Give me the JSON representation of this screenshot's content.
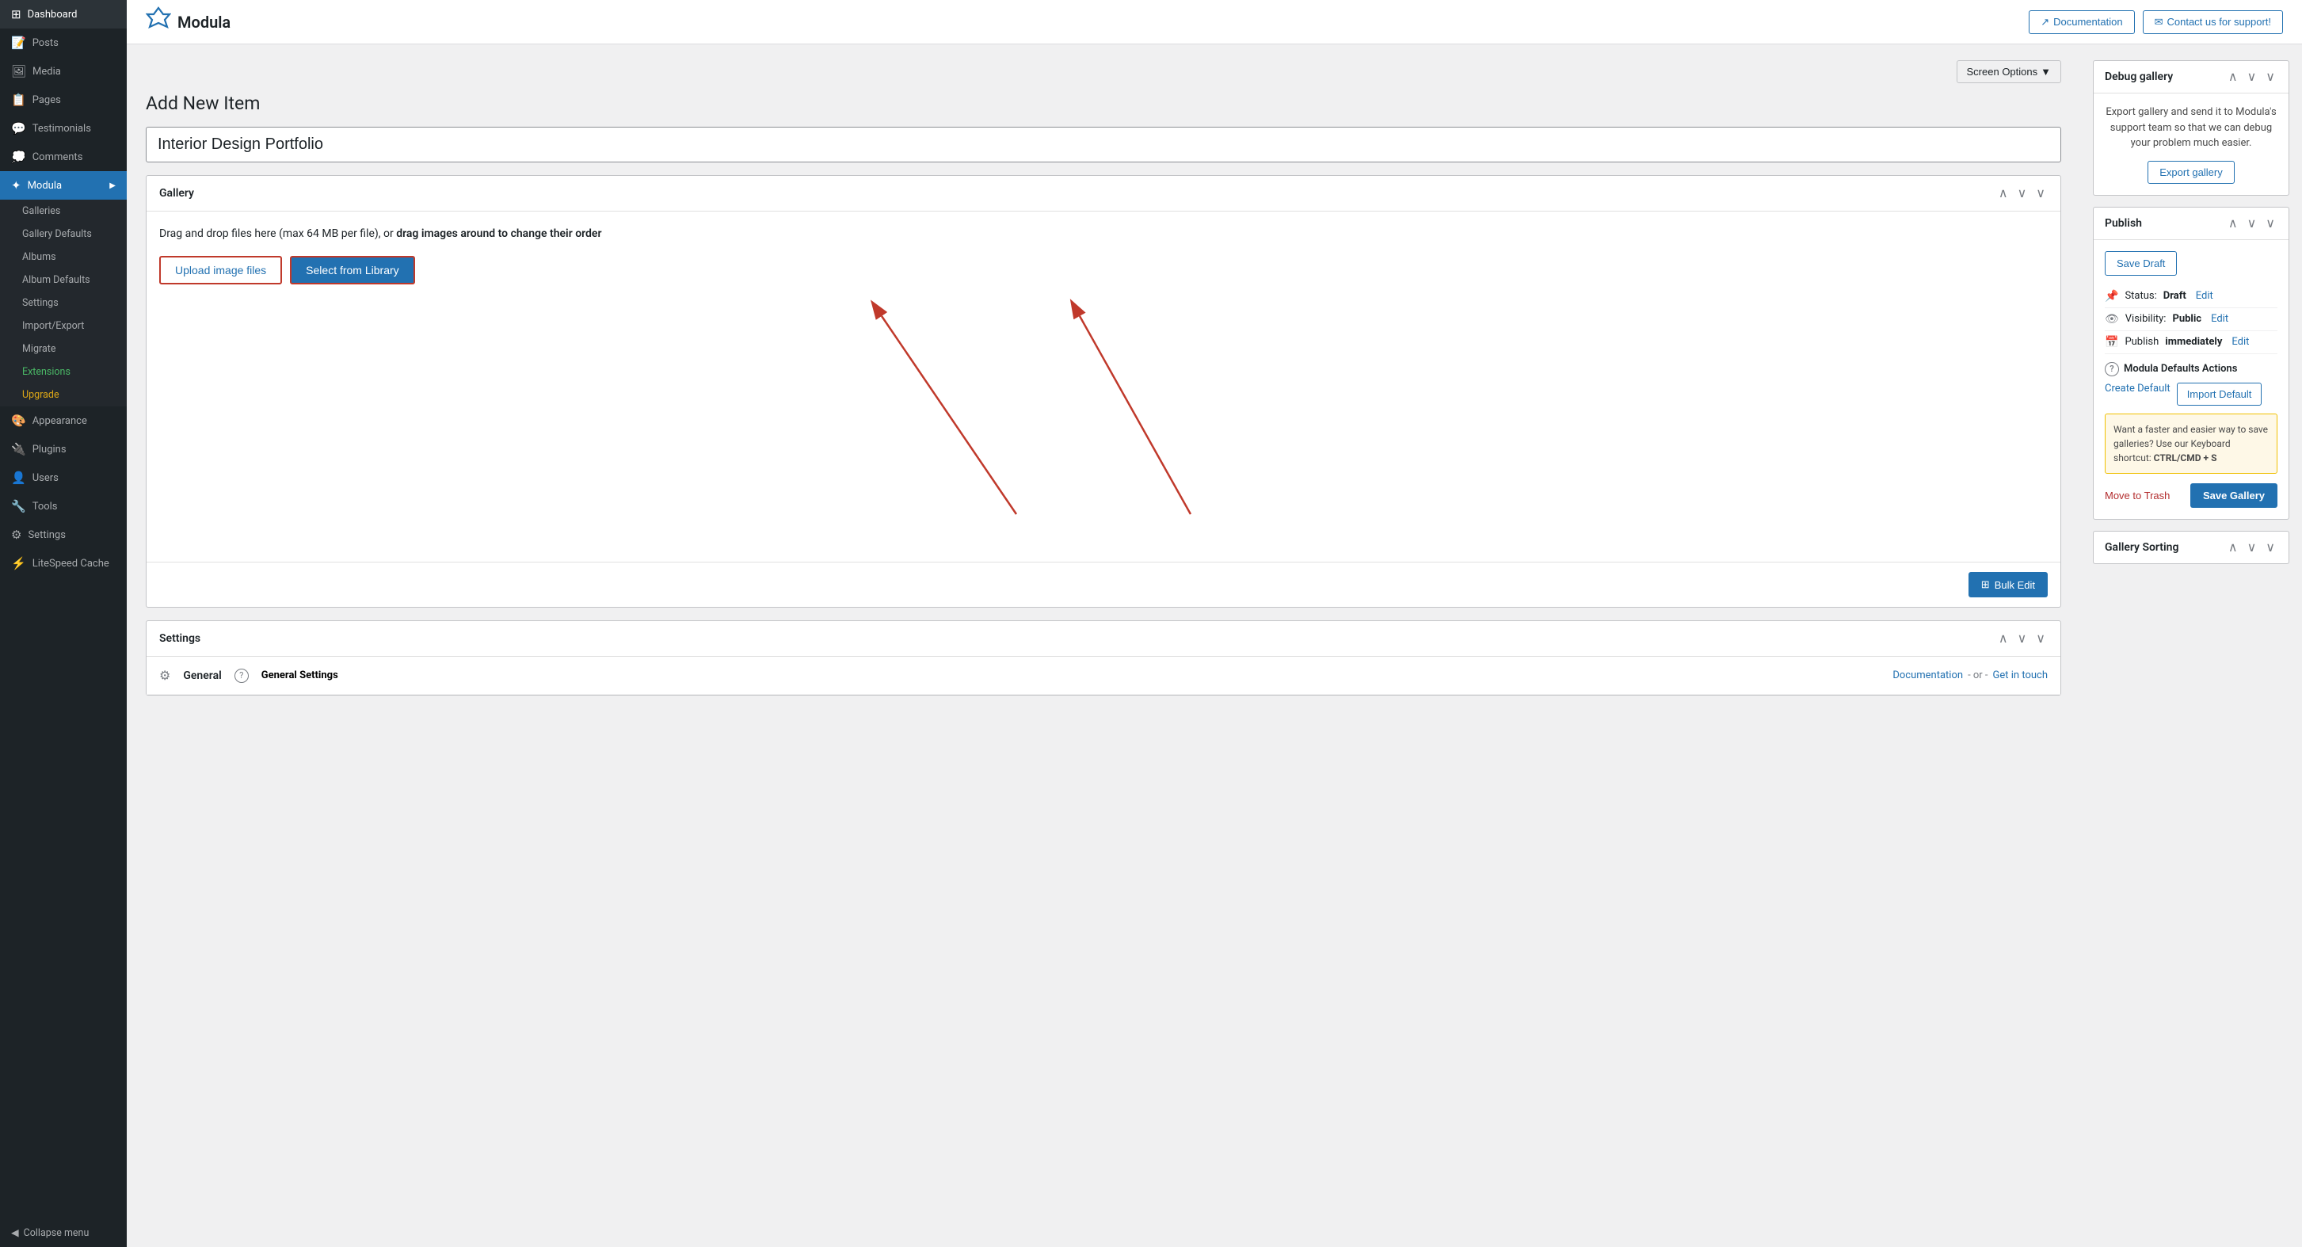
{
  "topbar": {
    "logo_text": "Modula",
    "doc_btn": "Documentation",
    "support_btn": "Contact us for support!"
  },
  "screen_options": "Screen Options",
  "page_title": "Add New Item",
  "gallery_name_placeholder": "Interior Design Portfolio",
  "gallery_panel": {
    "title": "Gallery",
    "drop_text": "Drag and drop files here (max 64 MB per file), or",
    "drop_text_bold": "drag images around to change their order",
    "upload_btn": "Upload image files",
    "library_btn": "Select from Library",
    "bulk_edit_btn": "Bulk Edit"
  },
  "settings_panel": {
    "title": "Settings",
    "general_icon": "⚙",
    "general_label": "General",
    "question_mark": "?",
    "general_settings_label": "General Settings",
    "doc_link": "Documentation",
    "or_text": "- or -",
    "get_in_touch": "Get in touch"
  },
  "sidebar": {
    "items": [
      {
        "label": "Dashboard",
        "icon": "⊞"
      },
      {
        "label": "Posts",
        "icon": "📄"
      },
      {
        "label": "Media",
        "icon": "🖼"
      },
      {
        "label": "Pages",
        "icon": "📋"
      },
      {
        "label": "Testimonials",
        "icon": "💬"
      },
      {
        "label": "Comments",
        "icon": "💭"
      },
      {
        "label": "Modula",
        "icon": "✦",
        "active": true
      },
      {
        "label": "Appearance",
        "icon": "🎨"
      },
      {
        "label": "Plugins",
        "icon": "🔌"
      },
      {
        "label": "Users",
        "icon": "👤"
      },
      {
        "label": "Tools",
        "icon": "🔧"
      },
      {
        "label": "Settings",
        "icon": "⚙"
      },
      {
        "label": "LiteSpeed Cache",
        "icon": "⚡"
      }
    ],
    "modula_submenu": [
      {
        "label": "Galleries",
        "color": "normal"
      },
      {
        "label": "Gallery Defaults",
        "color": "normal"
      },
      {
        "label": "Albums",
        "color": "normal"
      },
      {
        "label": "Album Defaults",
        "color": "normal"
      },
      {
        "label": "Settings",
        "color": "normal"
      },
      {
        "label": "Import/Export",
        "color": "normal"
      },
      {
        "label": "Migrate",
        "color": "normal"
      },
      {
        "label": "Extensions",
        "color": "green"
      },
      {
        "label": "Upgrade",
        "color": "yellow"
      }
    ],
    "collapse_label": "Collapse menu"
  },
  "debug_panel": {
    "title": "Debug gallery",
    "body_text": "Export gallery and send it to Modula's support team so that we can debug your problem much easier.",
    "export_btn": "Export gallery"
  },
  "publish_panel": {
    "title": "Publish",
    "save_draft_btn": "Save Draft",
    "status_label": "Status:",
    "status_value": "Draft",
    "status_link": "Edit",
    "visibility_label": "Visibility:",
    "visibility_value": "Public",
    "visibility_link": "Edit",
    "publish_label": "Publish",
    "publish_value": "immediately",
    "publish_link": "Edit",
    "defaults_title": "Modula Defaults Actions",
    "create_default": "Create Default",
    "import_default": "Import Default",
    "keyboard_tip": "Want a faster and easier way to save galleries? Use our Keyboard shortcut:",
    "keyboard_shortcut": "CTRL/CMD + S",
    "move_trash": "Move to Trash",
    "save_gallery": "Save Gallery"
  },
  "gallery_sorting": {
    "title": "Gallery Sorting"
  }
}
